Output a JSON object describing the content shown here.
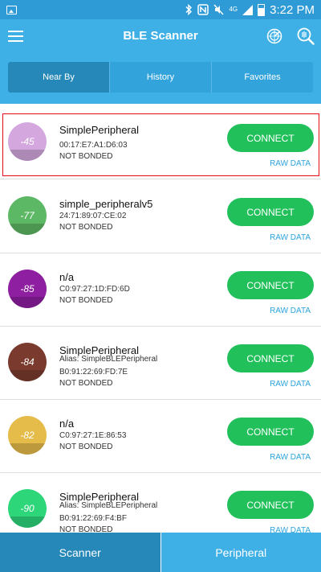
{
  "status_bar": {
    "time": "3:22 PM",
    "network_label": "4G",
    "icons": [
      "gallery-icon",
      "bluetooth-icon",
      "nfc-icon",
      "mute-icon",
      "signal-icon",
      "battery-icon"
    ]
  },
  "app_bar": {
    "title": "BLE Scanner",
    "icons": [
      "menu-icon",
      "radar-icon",
      "scan-icon"
    ]
  },
  "tabs": [
    {
      "label": "Near By",
      "active": true
    },
    {
      "label": "History",
      "active": false
    },
    {
      "label": "Favorites",
      "active": false
    }
  ],
  "devices": [
    {
      "name": "SimplePeripheral",
      "alias": "",
      "mac": "00:17:E7:A1:D6:03",
      "bond": "NOT BONDED",
      "rssi": "-45",
      "color": "#d4a8df",
      "connect_label": "CONNECT",
      "raw_label": "RAW DATA"
    },
    {
      "name": "simple_peripheralv5",
      "alias": "",
      "mac": "24:71:89:07:CE:02",
      "bond": "NOT BONDED",
      "rssi": "-77",
      "color": "#5db865",
      "connect_label": "CONNECT",
      "raw_label": "RAW DATA"
    },
    {
      "name": "n/a",
      "alias": "",
      "mac": "C0:97:27:1D:FD:6D",
      "bond": "NOT BONDED",
      "rssi": "-85",
      "color": "#8e1fa0",
      "connect_label": "CONNECT",
      "raw_label": "RAW DATA"
    },
    {
      "name": "SimplePeripheral",
      "alias": "Alias: SimpleBLEPeripheral",
      "mac": "B0:91:22:69:FD:7E",
      "bond": "NOT BONDED",
      "rssi": "-84",
      "color": "#7a3b2e",
      "connect_label": "CONNECT",
      "raw_label": "RAW DATA"
    },
    {
      "name": "n/a",
      "alias": "",
      "mac": "C0:97:27:1E:86:53",
      "bond": "NOT BONDED",
      "rssi": "-82",
      "color": "#e5bb4a",
      "connect_label": "CONNECT",
      "raw_label": "RAW DATA"
    },
    {
      "name": "SimplePeripheral",
      "alias": "Alias: SimpleBLEPeripheral",
      "mac": "B0:91:22:69:F4:BF",
      "bond": "NOT BONDED",
      "rssi": "-90",
      "color": "#2ed67a",
      "connect_label": "CONNECT",
      "raw_label": "RAW DATA"
    }
  ],
  "bottom_bar": {
    "scanner_label": "Scanner",
    "peripheral_label": "Peripheral"
  },
  "colors": {
    "app_bar": "#3fb0e6",
    "status_bar": "#2f9bd6",
    "active_tab": "#2588b9",
    "connect_button": "#22c05b",
    "raw_data_link": "#2da4dc",
    "highlight_border": "#e30b17"
  }
}
